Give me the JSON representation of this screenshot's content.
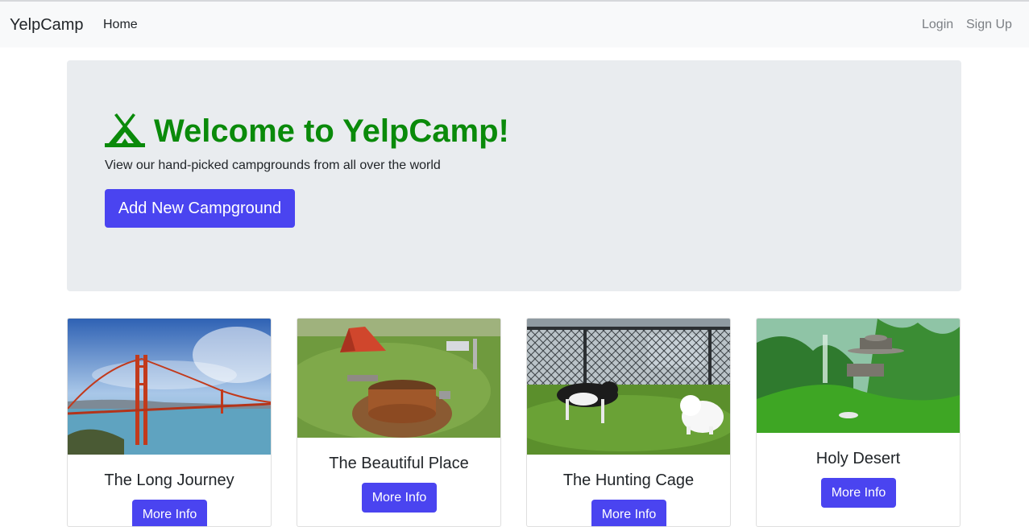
{
  "navbar": {
    "brand": "YelpCamp",
    "home": "Home",
    "login": "Login",
    "signup": "Sign Up"
  },
  "jumbotron": {
    "title": "Welcome to YelpCamp!",
    "lead": "View our hand-picked campgrounds from all over the world",
    "add_button": "Add New Campground",
    "title_color": "#0a8a0a"
  },
  "campgrounds": [
    {
      "name": "The Long Journey",
      "button": "More Info",
      "image": "golden-gate-bridge"
    },
    {
      "name": "The Beautiful Place",
      "button": "More Info",
      "image": "tent-fire-pit"
    },
    {
      "name": "The Hunting Cage",
      "button": "More Info",
      "image": "dogs-in-park"
    },
    {
      "name": "Holy Desert",
      "button": "More Info",
      "image": "green-mountain-temple"
    }
  ],
  "colors": {
    "primary_button": "#4a44f0",
    "jumbotron_bg": "#e9ecef",
    "navbar_bg": "#f8f9fa"
  }
}
